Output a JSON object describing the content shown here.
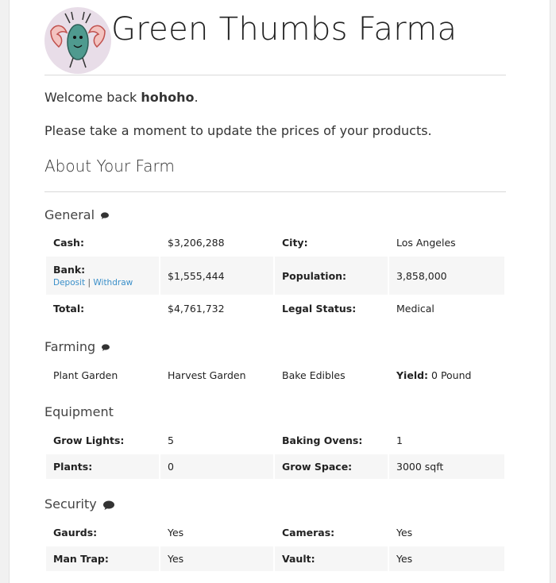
{
  "site": {
    "title": "Green Thumbs Farma"
  },
  "welcome": {
    "prefix": "Welcome back ",
    "username": "hohoho",
    "suffix": "."
  },
  "prompt": "Please take a moment to update the prices of your products.",
  "about_heading": "About Your Farm",
  "general": {
    "heading": "General",
    "cash_label": "Cash:",
    "cash_value": "$3,206,288",
    "city_label": "City:",
    "city_value": "Los Angeles",
    "bank_label": "Bank:",
    "deposit": "Deposit",
    "separator": "|",
    "withdraw": "Withdraw",
    "bank_value": "$1,555,444",
    "population_label": "Population:",
    "population_value": "3,858,000",
    "total_label": "Total:",
    "total_value": "$4,761,732",
    "legal_label": "Legal Status:",
    "legal_value": "Medical"
  },
  "farming": {
    "heading": "Farming",
    "plant": "Plant Garden",
    "harvest": "Harvest Garden",
    "bake": "Bake Edibles",
    "yield_label": "Yield:",
    "yield_value": " 0 Pound"
  },
  "equipment": {
    "heading": "Equipment",
    "lights_label": "Grow Lights:",
    "lights_value": "5",
    "ovens_label": "Baking Ovens:",
    "ovens_value": "1",
    "plants_label": "Plants:",
    "plants_value": "0",
    "space_label": "Grow Space:",
    "space_value": "3000 sqft"
  },
  "security": {
    "heading": "Security",
    "guards_label": "Gaurds:",
    "guards_value": "Yes",
    "cameras_label": "Cameras:",
    "cameras_value": "Yes",
    "mantrap_label": "Man Trap:",
    "mantrap_value": "Yes",
    "vault_label": "Vault:",
    "vault_value": "Yes"
  },
  "colors": {
    "link": "#3a8fc9",
    "alt_row": "#f6f6f6"
  },
  "icons": {
    "comment": "comment-icon",
    "logo": "bug-mascot-logo"
  }
}
